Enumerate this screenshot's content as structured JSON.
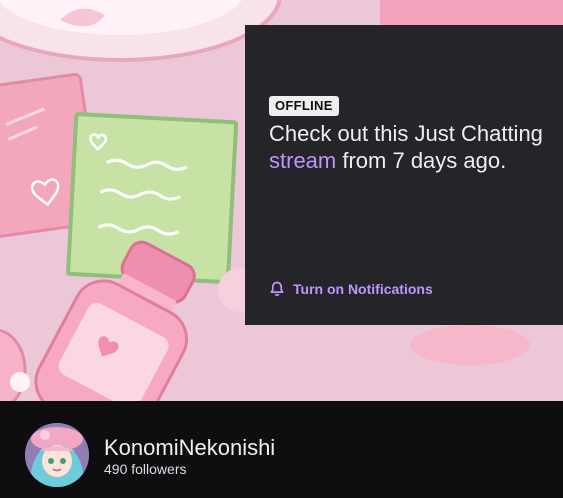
{
  "offline": {
    "badge": "OFFLINE",
    "message_before": "Check out this Just Chatting ",
    "message_link": "stream",
    "message_after": " from 7 days ago.",
    "notification_label": "Turn on Notifications",
    "notification_icon": "bell-icon"
  },
  "channel": {
    "name": "KonomiNekonishi",
    "followers": "490 followers"
  },
  "colors": {
    "accent": "#bf94ff",
    "panel_bg": "#252429",
    "page_bg": "#0e0e10",
    "banner_pink": "#ecc6d6"
  }
}
